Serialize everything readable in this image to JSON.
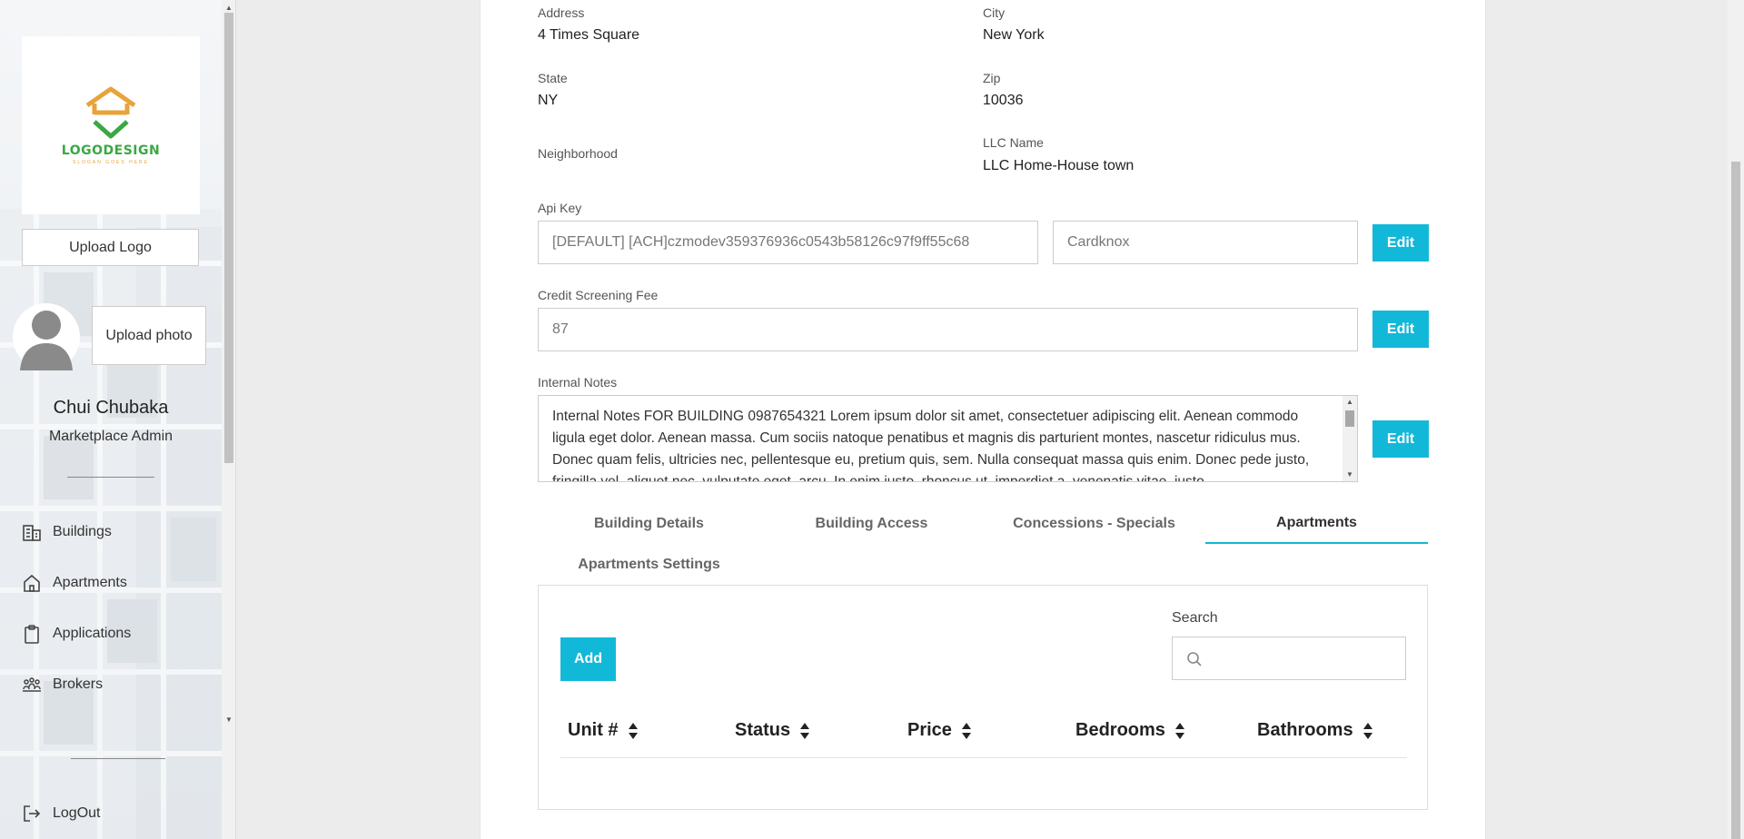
{
  "sidebar": {
    "logo": {
      "text": "LOGODESIGN",
      "subtext": "SLOGAN GOES HERE"
    },
    "upload_logo_label": "Upload Logo",
    "upload_photo_label": "Upload photo",
    "user": {
      "name": "Chui Chubaka",
      "role": "Marketplace Admin"
    },
    "nav": [
      {
        "label": "Buildings",
        "icon": "building-icon"
      },
      {
        "label": "Apartments",
        "icon": "home-icon"
      },
      {
        "label": "Applications",
        "icon": "clipboard-icon"
      },
      {
        "label": "Brokers",
        "icon": "people-icon"
      }
    ],
    "logout_label": "LogOut"
  },
  "details": {
    "address": {
      "label": "Address",
      "value": "4 Times Square"
    },
    "city": {
      "label": "City",
      "value": "New York"
    },
    "state": {
      "label": "State",
      "value": "NY"
    },
    "zip": {
      "label": "Zip",
      "value": "10036"
    },
    "neighborhood": {
      "label": "Neighborhood",
      "value": ""
    },
    "llc": {
      "label": "LLC Name",
      "value": "LLC Home-House town"
    },
    "api_key": {
      "label": "Api Key",
      "value": "[DEFAULT] [ACH]czmodev359376936c0543b58126c97f9ff55c68",
      "provider": "Cardknox"
    },
    "credit_fee": {
      "label": "Credit Screening Fee",
      "value": "87"
    },
    "notes": {
      "label": "Internal Notes",
      "value": "Internal Notes FOR BUILDING 0987654321 Lorem ipsum dolor sit amet, consectetuer adipiscing elit. Aenean commodo ligula eget dolor. Aenean massa. Cum sociis natoque penatibus et magnis dis parturient montes, nascetur ridiculus mus. Donec quam felis, ultricies nec, pellentesque eu, pretium quis, sem. Nulla consequat massa quis enim. Donec pede justo, fringilla vel, aliquet nec, vulputate eget, arcu. In enim justo, rhoncus ut, imperdiet a, venenatis vitae, justo."
    },
    "edit_label": "Edit"
  },
  "tabs": [
    {
      "label": "Building Details"
    },
    {
      "label": "Building Access"
    },
    {
      "label": "Concessions - Specials"
    },
    {
      "label": "Apartments",
      "active": true
    },
    {
      "label": "Apartments Settings"
    }
  ],
  "apartments_panel": {
    "add_label": "Add",
    "search_label": "Search",
    "search_value": "",
    "columns": [
      "Unit #",
      "Status",
      "Price",
      "Bedrooms",
      "Bathrooms"
    ]
  },
  "colors": {
    "accent": "#12b8d8",
    "logo_green": "#3aa843",
    "logo_orange": "#e8a33a"
  }
}
